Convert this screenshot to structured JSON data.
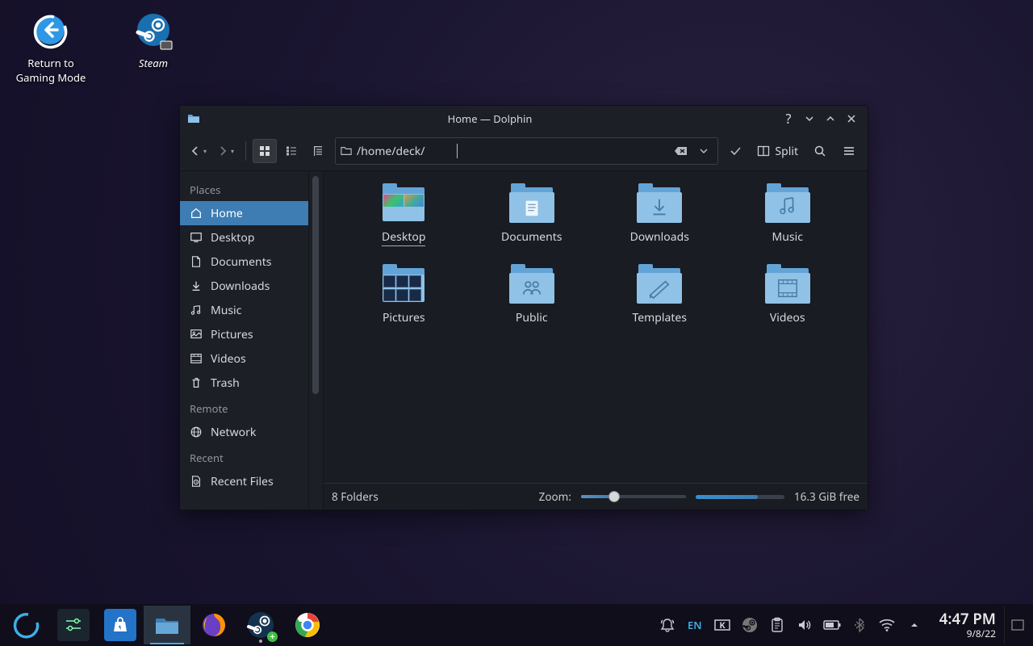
{
  "desktop": {
    "icons": [
      {
        "label": "Return to\nGaming Mode",
        "kind": "return"
      },
      {
        "label": "Steam",
        "kind": "steam"
      }
    ]
  },
  "window": {
    "title": "Home — Dolphin",
    "path": "/home/deck/",
    "split_label": "Split",
    "sidebar": {
      "sections": [
        {
          "heading": "Places",
          "items": [
            {
              "label": "Home",
              "icon": "home",
              "selected": true
            },
            {
              "label": "Desktop",
              "icon": "desktop"
            },
            {
              "label": "Documents",
              "icon": "documents"
            },
            {
              "label": "Downloads",
              "icon": "downloads"
            },
            {
              "label": "Music",
              "icon": "music"
            },
            {
              "label": "Pictures",
              "icon": "pictures"
            },
            {
              "label": "Videos",
              "icon": "videos"
            },
            {
              "label": "Trash",
              "icon": "trash"
            }
          ]
        },
        {
          "heading": "Remote",
          "items": [
            {
              "label": "Network",
              "icon": "network"
            }
          ]
        },
        {
          "heading": "Recent",
          "items": [
            {
              "label": "Recent Files",
              "icon": "recent"
            }
          ]
        }
      ]
    },
    "folders": [
      {
        "label": "Desktop",
        "glyph": "thumb1",
        "selected": true
      },
      {
        "label": "Documents",
        "glyph": "doc"
      },
      {
        "label": "Downloads",
        "glyph": "download"
      },
      {
        "label": "Music",
        "glyph": "music"
      },
      {
        "label": "Pictures",
        "glyph": "thumb2"
      },
      {
        "label": "Public",
        "glyph": "public"
      },
      {
        "label": "Templates",
        "glyph": "template"
      },
      {
        "label": "Videos",
        "glyph": "video"
      }
    ],
    "status": {
      "count_label": "8 Folders",
      "zoom_label": "Zoom:",
      "diskfree": "16.3 GiB free"
    }
  },
  "taskbar": {
    "tray_lang": "EN",
    "clock_time": "4:47 PM",
    "clock_date": "9/8/22"
  }
}
